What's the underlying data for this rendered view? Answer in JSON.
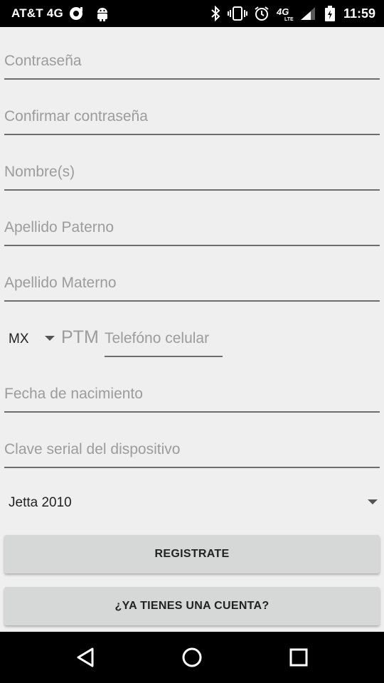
{
  "status_bar": {
    "carrier": "AT&T 4G",
    "time": "11:59",
    "icons": [
      "notification-icon",
      "android-icon",
      "bluetooth-icon",
      "vibrate-icon",
      "alarm-icon",
      "lte-4g-icon",
      "signal-icon",
      "battery-charging-icon"
    ]
  },
  "form": {
    "password_placeholder": "Contraseña",
    "confirm_password_placeholder": "Confirmar contraseña",
    "name_placeholder": "Nombre(s)",
    "paternal_surname_placeholder": "Apellido Paterno",
    "maternal_surname_placeholder": "Apellido Materno",
    "country_code": "MX",
    "phone_prefix": "PTM",
    "phone_placeholder": "Telefóno celular",
    "birthdate_placeholder": "Fecha de nacimiento",
    "device_serial_placeholder": "Clave serial del dispositivo",
    "vehicle_selected": "Jetta 2010"
  },
  "buttons": {
    "register_label": "REGISTRATE",
    "have_account_label": "¿YA TIENES UNA CUENTA?"
  },
  "nav_bar": {
    "icons": [
      "back-icon",
      "home-icon",
      "recents-icon"
    ]
  }
}
